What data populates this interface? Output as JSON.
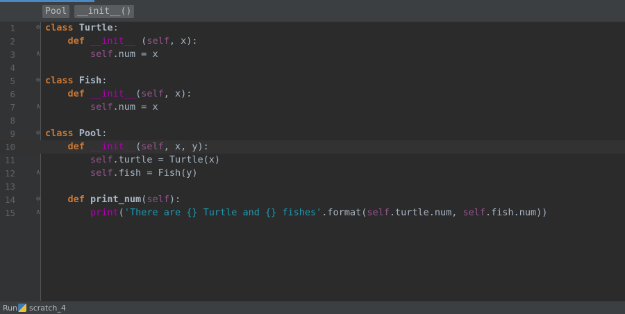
{
  "breadcrumb": {
    "items": [
      "Pool",
      "__init__()"
    ]
  },
  "lines": [
    {
      "num": "1",
      "tokens": [
        {
          "t": "class ",
          "c": "kw"
        },
        {
          "t": "Turtle",
          "c": "cls"
        },
        {
          "t": ":",
          "c": ""
        }
      ]
    },
    {
      "num": "2",
      "tokens": [
        {
          "t": "    ",
          "c": ""
        },
        {
          "t": "def ",
          "c": "kw"
        },
        {
          "t": "__init__",
          "c": "magic"
        },
        {
          "t": " (",
          "c": ""
        },
        {
          "t": "self",
          "c": "self"
        },
        {
          "t": ", x):",
          "c": ""
        }
      ]
    },
    {
      "num": "3",
      "tokens": [
        {
          "t": "        ",
          "c": ""
        },
        {
          "t": "self",
          "c": "self"
        },
        {
          "t": ".num = x",
          "c": ""
        }
      ]
    },
    {
      "num": "4",
      "tokens": []
    },
    {
      "num": "5",
      "tokens": [
        {
          "t": "class ",
          "c": "kw"
        },
        {
          "t": "Fish",
          "c": "cls"
        },
        {
          "t": ":",
          "c": ""
        }
      ]
    },
    {
      "num": "6",
      "tokens": [
        {
          "t": "    ",
          "c": ""
        },
        {
          "t": "def ",
          "c": "kw"
        },
        {
          "t": "__init__",
          "c": "magic"
        },
        {
          "t": "(",
          "c": ""
        },
        {
          "t": "self",
          "c": "self"
        },
        {
          "t": ", x):",
          "c": ""
        }
      ]
    },
    {
      "num": "7",
      "tokens": [
        {
          "t": "        ",
          "c": ""
        },
        {
          "t": "self",
          "c": "self"
        },
        {
          "t": ".num = x",
          "c": ""
        }
      ]
    },
    {
      "num": "8",
      "tokens": []
    },
    {
      "num": "9",
      "tokens": [
        {
          "t": "class ",
          "c": "kw"
        },
        {
          "t": "Pool",
          "c": "cls"
        },
        {
          "t": ":",
          "c": ""
        }
      ]
    },
    {
      "num": "10",
      "tokens": [
        {
          "t": "    ",
          "c": ""
        },
        {
          "t": "def ",
          "c": "kw"
        },
        {
          "t": "__init__",
          "c": "magic"
        },
        {
          "t": "(",
          "c": ""
        },
        {
          "t": "self",
          "c": "self"
        },
        {
          "t": ", x, y):",
          "c": ""
        }
      ],
      "current": true
    },
    {
      "num": "11",
      "tokens": [
        {
          "t": "        ",
          "c": ""
        },
        {
          "t": "self",
          "c": "self"
        },
        {
          "t": ".turtle = Turtle(x)",
          "c": ""
        }
      ]
    },
    {
      "num": "12",
      "tokens": [
        {
          "t": "        ",
          "c": ""
        },
        {
          "t": "self",
          "c": "self"
        },
        {
          "t": ".fish = Fish(y)",
          "c": ""
        }
      ]
    },
    {
      "num": "13",
      "tokens": []
    },
    {
      "num": "14",
      "tokens": [
        {
          "t": "    ",
          "c": ""
        },
        {
          "t": "def ",
          "c": "kw"
        },
        {
          "t": "print_num",
          "c": "fnb"
        },
        {
          "t": "(",
          "c": ""
        },
        {
          "t": "self",
          "c": "self"
        },
        {
          "t": "):",
          "c": ""
        }
      ]
    },
    {
      "num": "15",
      "tokens": [
        {
          "t": "        ",
          "c": ""
        },
        {
          "t": "print",
          "c": "magic"
        },
        {
          "t": "(",
          "c": ""
        },
        {
          "t": "'There are {} Turtle and {} fishes'",
          "c": "str2"
        },
        {
          "t": ".format(",
          "c": ""
        },
        {
          "t": "self",
          "c": "self"
        },
        {
          "t": ".turtle.num, ",
          "c": ""
        },
        {
          "t": "self",
          "c": "self"
        },
        {
          "t": ".fish.num))",
          "c": ""
        }
      ]
    }
  ],
  "statusbar": {
    "run_label": "Run",
    "run_icon": "python-icon",
    "config_name": "scratch_4"
  },
  "colors": {
    "keyword": "#cc7832",
    "self": "#94558d",
    "magic": "#b200b2",
    "string": "#1e9ab3",
    "text": "#a9b7c6",
    "background": "#2b2b2b"
  }
}
